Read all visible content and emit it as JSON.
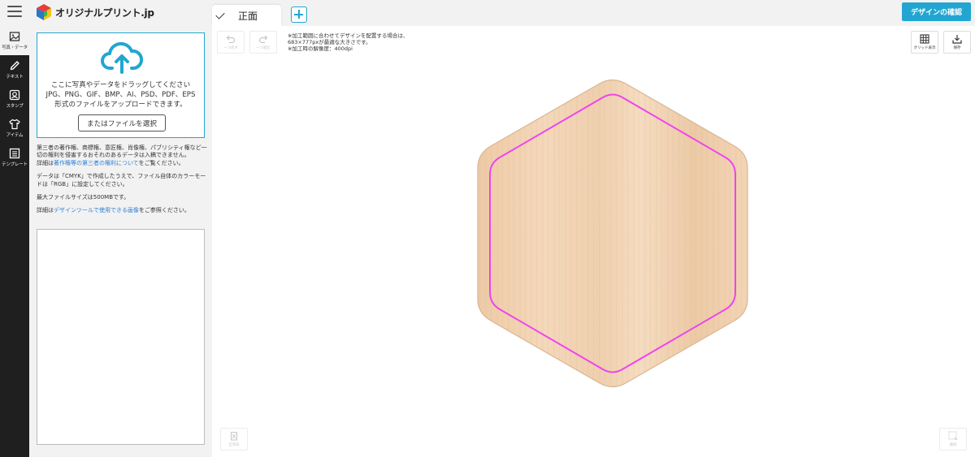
{
  "header": {
    "logo_text": "オリジナルプリント.jp",
    "face_tab_label": "正面",
    "confirm_label": "デザインの確認"
  },
  "sidenav": {
    "items": [
      {
        "label": "写真・データ",
        "icon": "image-icon"
      },
      {
        "label": "テキスト",
        "icon": "pencil-icon"
      },
      {
        "label": "スタンプ",
        "icon": "stamp-icon"
      },
      {
        "label": "アイテム",
        "icon": "tshirt-icon"
      },
      {
        "label": "テンプレート",
        "icon": "template-icon"
      }
    ]
  },
  "upload": {
    "drop_line1": "ここに写真やデータをドラッグしてください",
    "drop_line2": "JPG、PNG、GIF、BMP、AI、PSD、PDF、EPS",
    "drop_line3": "形式のファイルをアップロードできます。",
    "select_button": "またはファイルを選択"
  },
  "notes": {
    "rights_text": "第三者の著作権、商標権、意匠権、肖像権、パブリシティ権など一切の権利を侵害するおそれのあるデータは入稿できません。",
    "rights_detail_prefix": "詳細は",
    "rights_link": "著作権等の第三者の権利について",
    "rights_detail_suffix": "をご覧ください。",
    "cmyk_text": "データは「CMYK」で作成したうえで、ファイル自体のカラーモードは「RGB」に設定してください。",
    "max_size": "最大ファイルサイズは500MBです。",
    "images_prefix": "詳細は",
    "images_link": "デザインツールで使用できる画像",
    "images_suffix": "をご参照ください。"
  },
  "canvas": {
    "undo_label": "一つ戻す",
    "redo_label": "一つ進む",
    "info_line1": "※加工範囲に合わせてデザインを配置する場合は、",
    "info_line2": "683×777pxが最適な大きさです。",
    "info_line3": "※加工時の解像度：400dpi",
    "grid_label": "グリッド表示",
    "save_label": "保存",
    "delete_label": "全消去",
    "select_label": "選択"
  },
  "colors": {
    "accent": "#22a6d1",
    "nav_bg": "#1f1f1f",
    "guide_line": "#ee44ee",
    "wood": "#f1d4b4"
  }
}
